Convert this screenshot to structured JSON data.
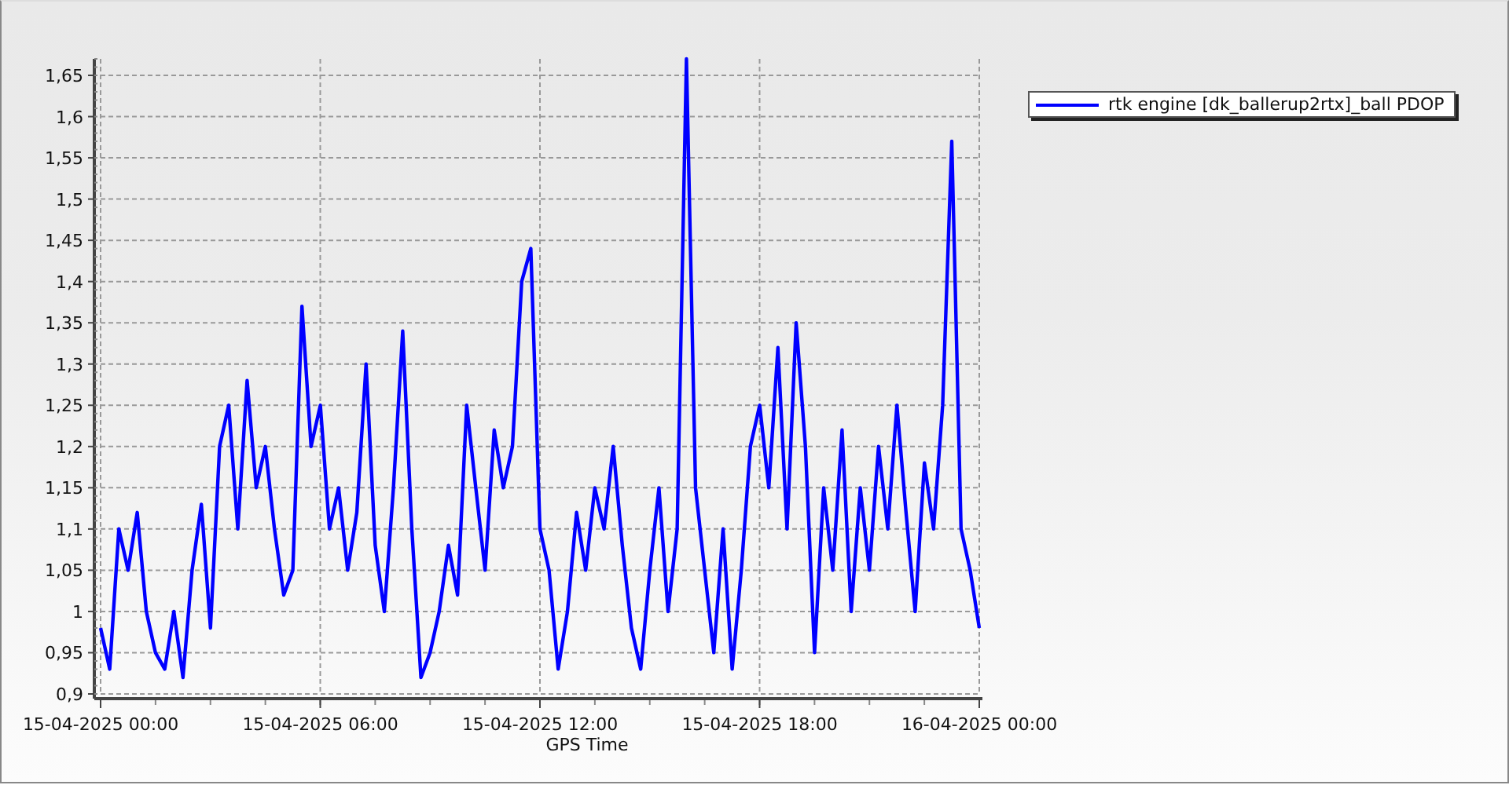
{
  "chart": {
    "chart_data": {
      "type": "line",
      "xlabel": "GPS Time",
      "grid": true,
      "ylim": [
        0.9,
        1.67
      ],
      "yticks": [
        {
          "value": 0.9,
          "label": "0,9"
        },
        {
          "value": 0.95,
          "label": "0,95"
        },
        {
          "value": 1,
          "label": "1"
        },
        {
          "value": 1.05,
          "label": "1,05"
        },
        {
          "value": 1.1,
          "label": "1,1"
        },
        {
          "value": 1.15,
          "label": "1,15"
        },
        {
          "value": 1.2,
          "label": "1,2"
        },
        {
          "value": 1.25,
          "label": "1,25"
        },
        {
          "value": 1.3,
          "label": "1,3"
        },
        {
          "value": 1.35,
          "label": "1,35"
        },
        {
          "value": 1.4,
          "label": "1,4"
        },
        {
          "value": 1.45,
          "label": "1,45"
        },
        {
          "value": 1.5,
          "label": "1,5"
        },
        {
          "value": 1.55,
          "label": "1,55"
        },
        {
          "value": 1.6,
          "label": "1,6"
        },
        {
          "value": 1.65,
          "label": "1,65"
        }
      ],
      "categories": [
        "15-04-2025 00:00",
        null,
        null,
        null,
        null,
        null,
        null,
        null,
        null,
        null,
        null,
        null,
        null,
        null,
        null,
        null,
        null,
        null,
        null,
        null,
        null,
        null,
        null,
        null,
        "15-04-2025 06:00",
        null,
        null,
        null,
        null,
        null,
        null,
        null,
        null,
        null,
        null,
        null,
        null,
        null,
        null,
        null,
        null,
        null,
        null,
        null,
        null,
        null,
        null,
        null,
        "15-04-2025 12:00",
        null,
        null,
        null,
        null,
        null,
        null,
        null,
        null,
        null,
        null,
        null,
        null,
        null,
        null,
        null,
        null,
        null,
        null,
        null,
        null,
        null,
        null,
        null,
        "15-04-2025 18:00",
        null,
        null,
        null,
        null,
        null,
        null,
        null,
        null,
        null,
        null,
        null,
        null,
        null,
        null,
        null,
        null,
        null,
        null,
        null,
        null,
        null,
        null,
        null,
        "16-04-2025 00:00"
      ],
      "series": [
        {
          "name": "rtk engine [dk_ballerup2rtx]_ball PDOP",
          "color": "#0000ff",
          "values": [
            0.98,
            0.93,
            1.1,
            1.05,
            1.12,
            1.0,
            0.95,
            0.93,
            1.0,
            0.92,
            1.05,
            1.13,
            0.98,
            1.2,
            1.25,
            1.1,
            1.28,
            1.15,
            1.2,
            1.1,
            1.02,
            1.05,
            1.37,
            1.2,
            1.25,
            1.1,
            1.15,
            1.05,
            1.12,
            1.3,
            1.08,
            1.0,
            1.15,
            1.34,
            1.1,
            0.92,
            0.95,
            1.0,
            1.08,
            1.02,
            1.25,
            1.15,
            1.05,
            1.22,
            1.15,
            1.2,
            1.4,
            1.44,
            1.1,
            1.05,
            0.93,
            1.0,
            1.12,
            1.05,
            1.15,
            1.1,
            1.2,
            1.08,
            0.98,
            0.93,
            1.05,
            1.15,
            1.0,
            1.1,
            1.67,
            1.15,
            1.05,
            0.95,
            1.1,
            0.93,
            1.05,
            1.2,
            1.25,
            1.15,
            1.32,
            1.1,
            1.35,
            1.2,
            0.95,
            1.15,
            1.05,
            1.22,
            1.0,
            1.15,
            1.05,
            1.2,
            1.1,
            1.25,
            1.12,
            1.0,
            1.18,
            1.1,
            1.25,
            1.57,
            1.1,
            1.05,
            0.98
          ]
        }
      ]
    }
  }
}
